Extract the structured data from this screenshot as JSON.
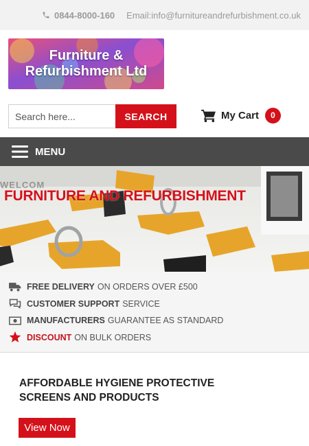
{
  "topbar": {
    "phone": "0844-8000-160",
    "email": "Email:info@furnitureandrefurbishment.co.uk"
  },
  "logo": {
    "line1": "Furniture &",
    "line2": "Refurbishment Ltd"
  },
  "search": {
    "placeholder": "Search here...",
    "button_label": "SEARCH"
  },
  "cart": {
    "label": "My Cart",
    "count": "0"
  },
  "menu": {
    "label": "MENU"
  },
  "hero": {
    "ghost_text": "WELCOM",
    "title": "FURNITURE AND REFURBISHMENT"
  },
  "features": [
    {
      "icon": "truck-icon",
      "bold": "FREE DELIVERY",
      "rest": "ON ORDERS OVER £500"
    },
    {
      "icon": "chat-icon",
      "bold": "CUSTOMER SUPPORT",
      "rest": "SERVICE"
    },
    {
      "icon": "money-icon",
      "bold": "MANUFACTURERS",
      "rest": "GUARANTEE AS STANDARD"
    },
    {
      "icon": "star-icon",
      "bold": "DISCOUNT",
      "rest": "ON BULK ORDERS"
    }
  ],
  "promo": {
    "heading": "AFFORDABLE HYGIENE PROTECTIVE SCREENS AND PRODUCTS",
    "button_label": "View Now"
  },
  "colors": {
    "accent_red": "#d4111a",
    "menu_bar": "#4a4a4a",
    "topbar_bg": "#f2f2f2",
    "feature_bg": "#f5f5f5"
  }
}
